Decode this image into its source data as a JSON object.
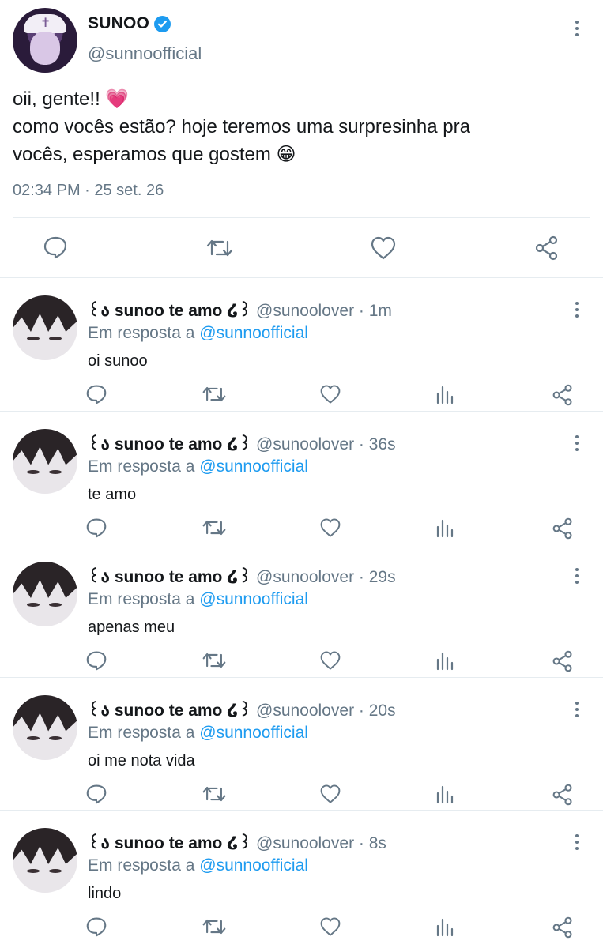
{
  "main_tweet": {
    "display_name": "SUNOO",
    "handle": "@sunnoofficial",
    "lines": [
      "oii, gente!! 💗",
      "como vocês estão? hoje teremos uma surpresinha pra",
      "vocês, esperamos que gostem 😁"
    ],
    "timestamp": "02:34 PM · 25 set. 26"
  },
  "replies": [
    {
      "display_name": "꒰ა sunoo te amo ໒꒱",
      "meta": "@sunoolover · 1m",
      "reply_prefix": "Em resposta a",
      "reply_to": "@sunnoofficial",
      "text": "oi sunoo"
    },
    {
      "display_name": "꒰ა sunoo te amo ໒꒱",
      "meta": "@sunoolover · 36s",
      "reply_prefix": "Em resposta a",
      "reply_to": "@sunnoofficial",
      "text": "te amo"
    },
    {
      "display_name": "꒰ა sunoo te amo ໒꒱",
      "meta": "@sunoolover · 29s",
      "reply_prefix": "Em resposta a",
      "reply_to": "@sunnoofficial",
      "text": "apenas meu"
    },
    {
      "display_name": "꒰ა sunoo te amo ໒꒱",
      "meta": "@sunoolover · 20s",
      "reply_prefix": "Em resposta a",
      "reply_to": "@sunnoofficial",
      "text": "oi me nota vida"
    },
    {
      "display_name": "꒰ა sunoo te amo ໒꒱",
      "meta": "@sunoolover · 8s",
      "reply_prefix": "Em resposta a",
      "reply_to": "@sunnoofficial",
      "text": "lindo"
    }
  ],
  "icons": [
    "reply-icon",
    "retweet-icon",
    "like-icon",
    "views-icon",
    "share-icon",
    "more-icon",
    "verified-badge-icon"
  ],
  "colors": {
    "accent": "#1d9bf0",
    "muted": "#657786",
    "text": "#14171a",
    "divider": "#e6ecf0"
  }
}
